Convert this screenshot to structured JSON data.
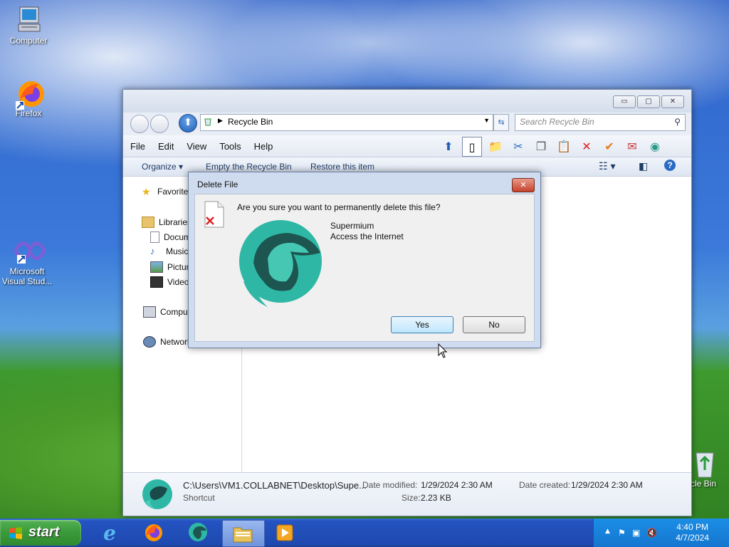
{
  "desktop": {
    "icons": [
      {
        "label": "Computer"
      },
      {
        "label": "Firefox"
      },
      {
        "label": "Microsoft Visual Stud..."
      },
      {
        "label": "cle Bin"
      }
    ]
  },
  "explorer": {
    "window_buttons": {
      "minimize": "▭",
      "maximize": "▢",
      "close": "✕"
    },
    "address": {
      "path": "Recycle Bin"
    },
    "search": {
      "placeholder": "Search Recycle Bin"
    },
    "menu": [
      "File",
      "Edit",
      "View",
      "Tools",
      "Help"
    ],
    "commands": {
      "organize": "Organize ▾",
      "empty": "Empty the Recycle Bin",
      "restore": "Restore this item"
    },
    "nav": {
      "favorites": "Favorites",
      "libraries": "Libraries",
      "documents": "Documents",
      "music": "Music",
      "pictures": "Pictures",
      "videos": "Videos",
      "computer": "Computer",
      "network": "Network"
    },
    "details": {
      "path": "C:\\Users\\VM1.COLLABNET\\Desktop\\Supe...",
      "type": "Shortcut",
      "date_modified_label": "Date modified:",
      "date_modified": "1/29/2024 2:30 AM",
      "date_created_label": "Date created:",
      "date_created": "1/29/2024 2:30 AM",
      "size_label": "Size:",
      "size": "2.23 KB"
    }
  },
  "dialog": {
    "title": "Delete File",
    "question": "Are you sure you want to permanently delete this file?",
    "item_name": "Supermium",
    "item_description": "Access the Internet",
    "yes": "Yes",
    "no": "No",
    "close": "✕"
  },
  "taskbar": {
    "start_label": "start",
    "clock_time": "4:40 PM",
    "clock_date": "4/7/2024"
  },
  "colors": {
    "taskbar_blue": "#2453c1",
    "start_green": "#3a9a3a",
    "tray_blue": "#1576cf",
    "supermium_teal": "#2fb7a5"
  }
}
